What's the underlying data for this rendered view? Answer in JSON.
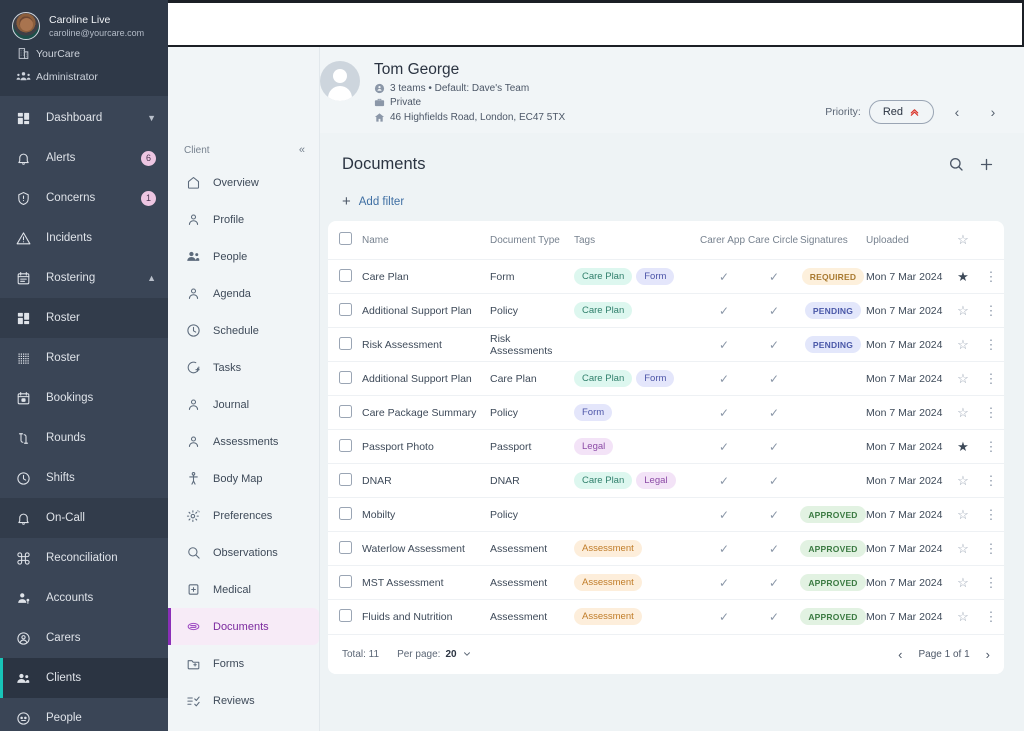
{
  "nav": {
    "user": {
      "name": "Caroline Live",
      "email": "caroline@yourcare.com"
    },
    "org": "YourCare",
    "role": "Administrator",
    "items": [
      {
        "label": "Dashboard",
        "icon": "grid-icon",
        "badge": "",
        "chevron": "down",
        "state": ""
      },
      {
        "label": "Alerts",
        "icon": "bell-icon",
        "badge": "6",
        "chevron": "",
        "state": ""
      },
      {
        "label": "Concerns",
        "icon": "shield-alert-icon",
        "badge": "1",
        "chevron": "",
        "state": ""
      },
      {
        "label": "Incidents",
        "icon": "warning-icon",
        "badge": "",
        "chevron": "",
        "state": ""
      },
      {
        "label": "Rostering",
        "icon": "calendar-icon",
        "badge": "",
        "chevron": "up",
        "state": ""
      },
      {
        "label": "Roster",
        "icon": "grid-icon",
        "badge": "",
        "chevron": "",
        "state": "sub"
      },
      {
        "label": "Roster",
        "icon": "dots-grid-icon",
        "badge": "",
        "chevron": "",
        "state": ""
      },
      {
        "label": "Bookings",
        "icon": "calendar-day-icon",
        "badge": "",
        "chevron": "",
        "state": ""
      },
      {
        "label": "Rounds",
        "icon": "rounds-icon",
        "badge": "",
        "chevron": "",
        "state": ""
      },
      {
        "label": "Shifts",
        "icon": "clock-icon",
        "badge": "",
        "chevron": "",
        "state": ""
      },
      {
        "label": "On-Call",
        "icon": "bell-icon",
        "badge": "",
        "chevron": "",
        "state": "sub"
      },
      {
        "label": "Reconciliation",
        "icon": "command-icon",
        "badge": "",
        "chevron": "",
        "state": ""
      },
      {
        "label": "Accounts",
        "icon": "user-key-icon",
        "badge": "",
        "chevron": "",
        "state": ""
      },
      {
        "label": "Carers",
        "icon": "user-circle-icon",
        "badge": "",
        "chevron": "",
        "state": ""
      },
      {
        "label": "Clients",
        "icon": "users-icon",
        "badge": "",
        "chevron": "",
        "state": "active"
      },
      {
        "label": "People",
        "icon": "face-icon",
        "badge": "",
        "chevron": "",
        "state": ""
      }
    ]
  },
  "client": {
    "name": "Tom George",
    "teams": "3 teams • Default: Dave's Team",
    "visibility": "Private",
    "address": "46 Highfields Road, London, EC47 5TX",
    "priority_label": "Priority:",
    "priority_value": "Red"
  },
  "subnav": {
    "header": "Client",
    "collapse": "«",
    "items": [
      {
        "label": "Overview",
        "icon": "home-icon",
        "active": false
      },
      {
        "label": "Profile",
        "icon": "user-icon",
        "active": false
      },
      {
        "label": "People",
        "icon": "users-icon",
        "active": false
      },
      {
        "label": "Agenda",
        "icon": "user-icon",
        "active": false
      },
      {
        "label": "Schedule",
        "icon": "clock-icon",
        "active": false
      },
      {
        "label": "Tasks",
        "icon": "check-circle-icon",
        "active": false
      },
      {
        "label": "Journal",
        "icon": "user-icon",
        "active": false
      },
      {
        "label": "Assessments",
        "icon": "user-icon",
        "active": false
      },
      {
        "label": "Body Map",
        "icon": "body-icon",
        "active": false
      },
      {
        "label": "Preferences",
        "icon": "gear-icon",
        "active": false
      },
      {
        "label": "Observations",
        "icon": "search-icon",
        "active": false
      },
      {
        "label": "Medical",
        "icon": "pill-box-icon",
        "active": false
      },
      {
        "label": "Documents",
        "icon": "documents-icon",
        "active": true
      },
      {
        "label": "Forms",
        "icon": "folder-plus-icon",
        "active": false
      },
      {
        "label": "Reviews",
        "icon": "list-check-icon",
        "active": false
      }
    ]
  },
  "docs": {
    "title": "Documents",
    "add_filter": "Add filter",
    "columns": [
      "Name",
      "Document Type",
      "Tags",
      "Carer App",
      "Care Circle",
      "Signatures",
      "Uploaded"
    ],
    "rows": [
      {
        "name": "Care Plan",
        "type": "Form",
        "tags": [
          "Care Plan",
          "Form"
        ],
        "carer": true,
        "circle": true,
        "signature": "REQUIRED",
        "uploaded": "Mon 7 Mar 2024",
        "starred": true
      },
      {
        "name": "Additional Support Plan",
        "type": "Policy",
        "tags": [
          "Care Plan"
        ],
        "carer": true,
        "circle": true,
        "signature": "PENDING",
        "uploaded": "Mon 7 Mar 2024",
        "starred": false
      },
      {
        "name": "Risk Assessment",
        "type": "Risk Assessments",
        "tags": [],
        "carer": true,
        "circle": true,
        "signature": "PENDING",
        "uploaded": "Mon 7 Mar 2024",
        "starred": false
      },
      {
        "name": "Additional Support Plan",
        "type": "Care Plan",
        "tags": [
          "Care Plan",
          "Form"
        ],
        "carer": true,
        "circle": true,
        "signature": "",
        "uploaded": "Mon 7 Mar 2024",
        "starred": false
      },
      {
        "name": "Care Package Summary",
        "type": "Policy",
        "tags": [
          "Form"
        ],
        "carer": true,
        "circle": true,
        "signature": "",
        "uploaded": "Mon 7 Mar 2024",
        "starred": false
      },
      {
        "name": "Passport Photo",
        "type": "Passport",
        "tags": [
          "Legal"
        ],
        "carer": true,
        "circle": true,
        "signature": "",
        "uploaded": "Mon 7 Mar 2024",
        "starred": true
      },
      {
        "name": "DNAR",
        "type": "DNAR",
        "tags": [
          "Care Plan",
          "Legal"
        ],
        "carer": true,
        "circle": true,
        "signature": "",
        "uploaded": "Mon 7 Mar 2024",
        "starred": false
      },
      {
        "name": "Mobilty",
        "type": "Policy",
        "tags": [],
        "carer": true,
        "circle": true,
        "signature": "APPROVED",
        "uploaded": "Mon 7 Mar 2024",
        "starred": false
      },
      {
        "name": "Waterlow Assessment",
        "type": "Assessment",
        "tags": [
          "Assessment"
        ],
        "carer": true,
        "circle": true,
        "signature": "APPROVED",
        "uploaded": "Mon 7 Mar 2024",
        "starred": false
      },
      {
        "name": "MST Assessment",
        "type": "Assessment",
        "tags": [
          "Assessment"
        ],
        "carer": true,
        "circle": true,
        "signature": "APPROVED",
        "uploaded": "Mon 7 Mar 2024",
        "starred": false
      },
      {
        "name": "Fluids and Nutrition",
        "type": "Assessment",
        "tags": [
          "Assessment"
        ],
        "carer": true,
        "circle": true,
        "signature": "APPROVED",
        "uploaded": "Mon 7 Mar 2024",
        "starred": false
      }
    ],
    "footer": {
      "total": "Total: 11",
      "per_page_label": "Per page:",
      "per_page_value": "20",
      "page_text": "Page 1 of 1"
    }
  },
  "colors": {
    "nav_bg": "#3a4556",
    "accent_teal": "#18c4b8",
    "accent_purple": "#8b2fb8",
    "priority_red": "#d93025"
  }
}
